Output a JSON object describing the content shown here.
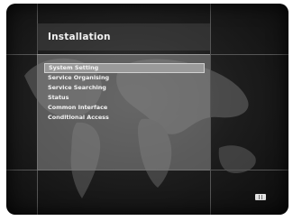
{
  "screen": {
    "title": "Installation"
  },
  "menu": {
    "items": [
      {
        "label": "System Setting",
        "selected": true
      },
      {
        "label": "Service Organising",
        "selected": false
      },
      {
        "label": "Service Searching",
        "selected": false
      },
      {
        "label": "Status",
        "selected": false
      },
      {
        "label": "Common Interface",
        "selected": false
      },
      {
        "label": "Conditional Access",
        "selected": false
      }
    ]
  },
  "footer": {
    "icon": "remote-button-icon"
  }
}
